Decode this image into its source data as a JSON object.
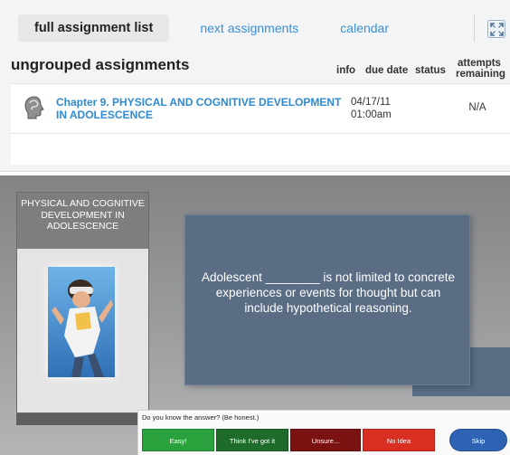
{
  "tabs": {
    "active": "full assignment list",
    "next": "next assignments",
    "calendar": "calendar",
    "expand_icon": "expand-icon"
  },
  "group": {
    "title": "ungrouped assignments",
    "columns": {
      "info": "info",
      "due_date": "due date",
      "status": "status",
      "attempts_line1": "attempts",
      "attempts_line2": "remaining"
    }
  },
  "assignments": [
    {
      "icon": "brain-head-icon",
      "title": "Chapter 9. PHYSICAL AND COGNITIVE DEVELOPMENT IN ADOLESCENCE",
      "due_line1": "04/17/11",
      "due_line2": "01:00am",
      "attempts": "N/A"
    }
  ],
  "flashcard": {
    "topic": "PHYSICAL AND COGNITIVE DEVELOPMENT IN ADOLESCENCE",
    "question": "Adolescent ________ is not limited to concrete experiences or events for thought but can include hypothetical reasoning."
  },
  "answer_bar": {
    "prompt": "Do you know the answer? (Be honest.)",
    "buttons": {
      "easy": "Easy!",
      "think": "Think I've got it",
      "unsure": "Unsure...",
      "no_idea": "No Idea",
      "skip": "Skip"
    }
  },
  "colors": {
    "link": "#3a8fd6",
    "card": "#5a6d85",
    "easy": "#2aa13c",
    "think": "#1f6b2c",
    "unsure": "#7a1212",
    "no_idea": "#d92e22",
    "skip": "#2d63b2"
  }
}
